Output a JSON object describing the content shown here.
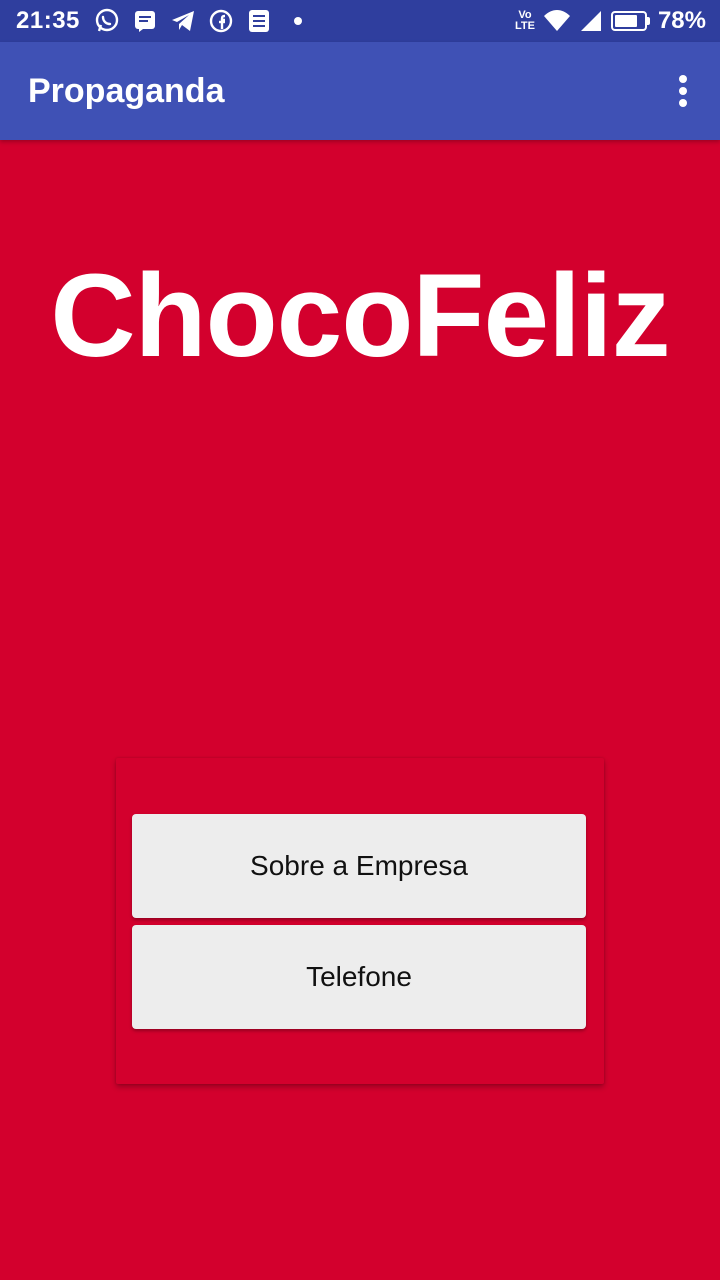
{
  "status_bar": {
    "time": "21:35",
    "notification_icons": [
      "whatsapp-icon",
      "message-icon",
      "telegram-icon",
      "facebook-icon",
      "notes-icon"
    ],
    "network": [
      "Vo",
      "LTE"
    ],
    "battery_percent": "78%",
    "battery_level": 0.78
  },
  "app_bar": {
    "title": "Propaganda",
    "menu_icon": "overflow-menu-icon"
  },
  "main": {
    "brand": "ChocoFeliz",
    "buttons": [
      {
        "label": "Sobre a Empresa"
      },
      {
        "label": "Telefone"
      }
    ]
  },
  "colors": {
    "status_bar": "#2F3E9E",
    "app_bar": "#3F51B5",
    "background": "#D3002D",
    "button": "#EDEDED"
  }
}
